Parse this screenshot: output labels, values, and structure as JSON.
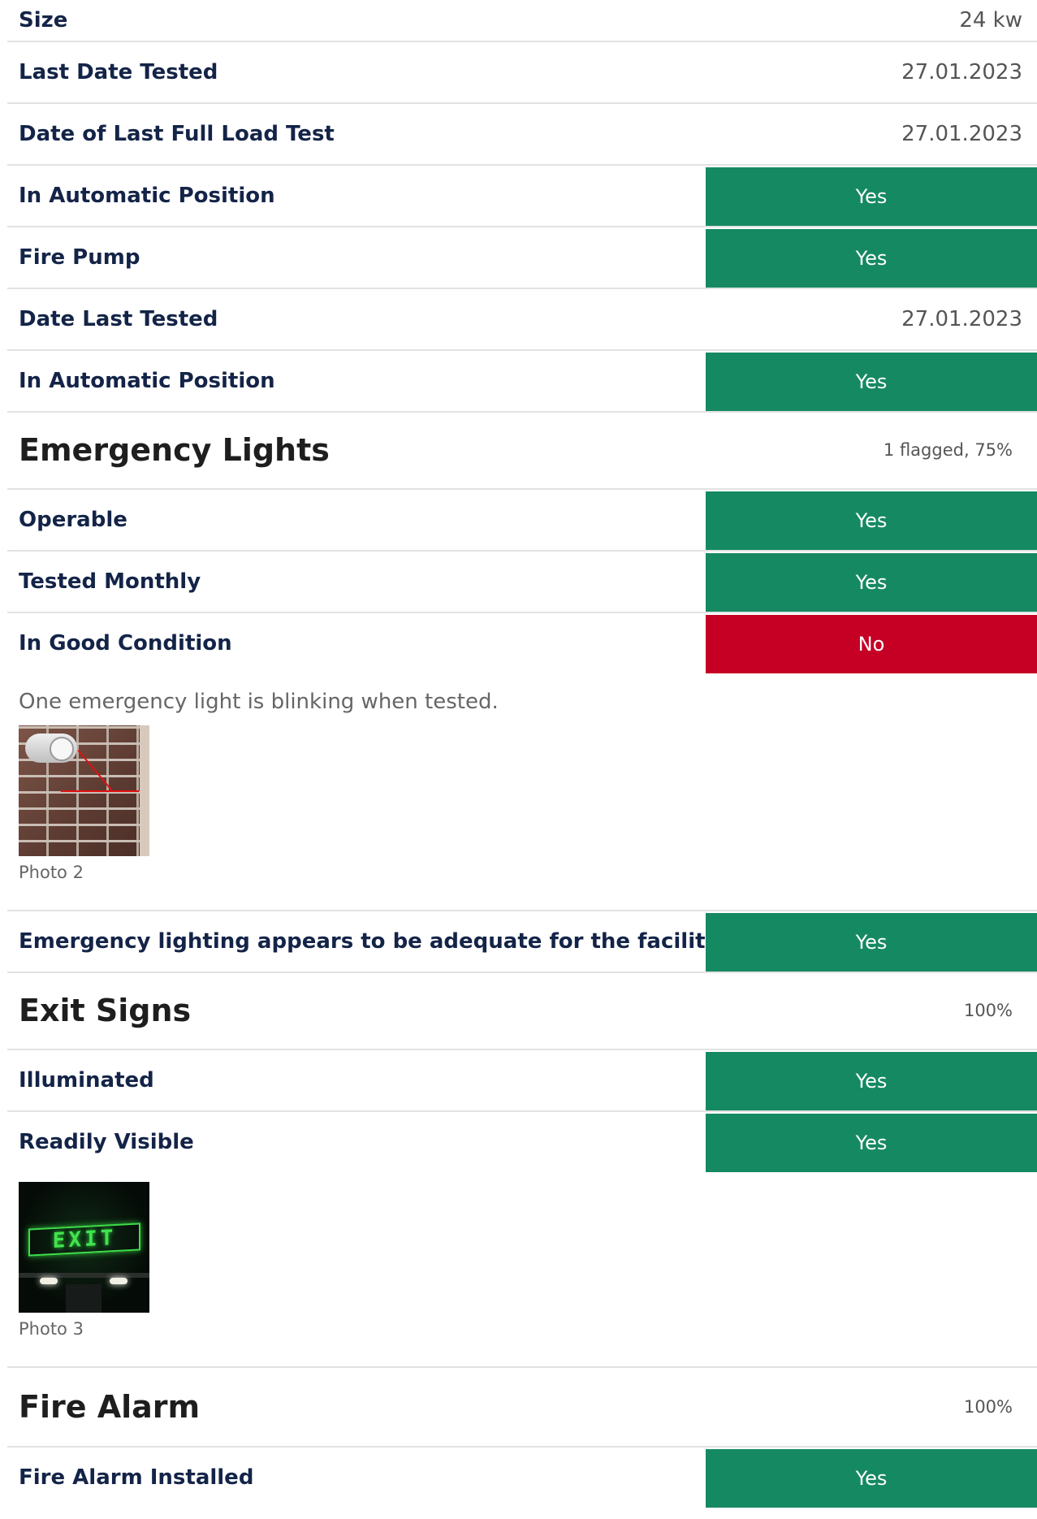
{
  "top_rows": [
    {
      "label": "Size",
      "value": "24 kw"
    },
    {
      "label": "Last Date Tested",
      "value": "27.01.2023"
    },
    {
      "label": "Date of Last Full Load Test",
      "value": "27.01.2023"
    },
    {
      "label": "In Automatic Position",
      "answer": "Yes"
    },
    {
      "label": "Fire Pump",
      "answer": "Yes"
    },
    {
      "label": "Date Last Tested",
      "value": "27.01.2023"
    },
    {
      "label": "In Automatic Position",
      "answer": "Yes"
    }
  ],
  "emergency_lights": {
    "title": "Emergency Lights",
    "stat": "1 flagged, 75%",
    "rows": [
      {
        "label": "Operable",
        "answer": "Yes"
      },
      {
        "label": "Tested Monthly",
        "answer": "Yes"
      },
      {
        "label": "In Good Condition",
        "answer": "No"
      }
    ],
    "note": "One emergency light is blinking when tested.",
    "photo_caption": "Photo 2",
    "after_photo_rows": [
      {
        "label": "Emergency lighting appears to be adequate for the facility",
        "answer": "Yes"
      }
    ]
  },
  "exit_signs": {
    "title": "Exit Signs",
    "stat": "100%",
    "rows": [
      {
        "label": "Illuminated",
        "answer": "Yes"
      },
      {
        "label": "Readily Visible",
        "answer": "Yes"
      }
    ],
    "photo_caption": "Photo 3",
    "sign_text": "EXIT"
  },
  "fire_alarm": {
    "title": "Fire Alarm",
    "stat": "100%",
    "rows": [
      {
        "label": "Fire Alarm Installed",
        "answer": "Yes"
      }
    ]
  },
  "colors": {
    "yes": "#158962",
    "no": "#c50024",
    "label": "#142448"
  }
}
